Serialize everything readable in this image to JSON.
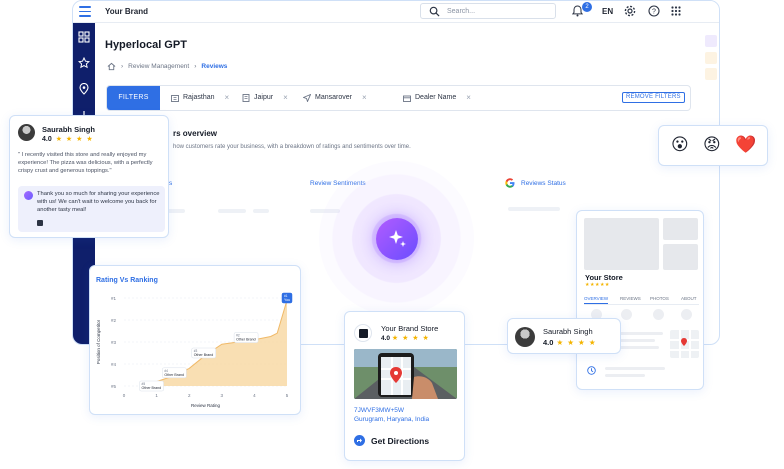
{
  "header": {
    "brand": "Your Brand",
    "search_placeholder": "Search...",
    "notification_count": "2",
    "language": "EN"
  },
  "page": {
    "title": "Hyperlocal GPT",
    "breadcrumb": [
      "Review Management",
      "Reviews"
    ]
  },
  "filters": {
    "button_label": "FILTERS",
    "chips": [
      "Rajasthan",
      "Jaipur",
      "Mansarover",
      "Dealer Name"
    ],
    "remove_label": "REMOVE FILTERS"
  },
  "overview": {
    "title_fragment": "rs overview",
    "subtitle_fragment": "how customers rate your business, with a breakdown of ratings and sentiments over time.",
    "left_section_fragment": "s",
    "sentiments_label": "Review Sentiments",
    "status_label": "Reviews Status"
  },
  "review_card": {
    "name": "Saurabh Singh",
    "rating": "4.0",
    "stars": "★ ★ ★ ★",
    "quote": "\" I recently visited this store and really enjoyed my experience! The pizza was delicious, with a perfectly crispy crust and generous toppings.\"",
    "reply": "Thank you so much for sharing your experience with us! We can't wait to welcome you back for another tasty meal!"
  },
  "emojis": [
    "😮",
    "😡",
    "❤️"
  ],
  "chart_data": {
    "type": "area",
    "title": "Rating Vs Ranking",
    "xlabel": "Review Rating",
    "ylabel": "Position of Competitor",
    "x_ticks": [
      "0",
      "1",
      "2",
      "3",
      "4",
      "5"
    ],
    "y_ticks": [
      "#1",
      "#2",
      "#3",
      "#4",
      "#5"
    ],
    "x": [
      1,
      1.5,
      2,
      2.5,
      3,
      3.5,
      4,
      4.5,
      4.7,
      5
    ],
    "y": [
      4.8,
      4.55,
      4.2,
      3.6,
      3.1,
      3.0,
      2.9,
      2.75,
      2.6,
      1.1
    ],
    "annotations": [
      {
        "id": "#5",
        "label": "Other Brand",
        "x": 0.6,
        "y": 5
      },
      {
        "id": "#4",
        "label": "Other Brand",
        "x": 1.3,
        "y": 4.4
      },
      {
        "id": "#3",
        "label": "Other Brand",
        "x": 2.2,
        "y": 3.5
      },
      {
        "id": "#2",
        "label": "Other Brand",
        "x": 3.5,
        "y": 2.8
      },
      {
        "id": "#1",
        "label": "You",
        "x": 5,
        "y": 1
      }
    ]
  },
  "store_card": {
    "name": "Your Brand Store",
    "rating": "4.0",
    "stars": "★ ★ ★ ★",
    "address_code": "7JWVF3MW+5W",
    "address_city": "Gurugram, Haryana, India",
    "directions_label": "Get Directions"
  },
  "profile_card": {
    "name": "Your Store",
    "stars": "★★★★★",
    "tabs": [
      "OVERVIEW",
      "REVIEWS",
      "PHOTOS",
      "ABOUT"
    ]
  },
  "reviewer_card": {
    "name": "Saurabh Singh",
    "rating": "4.0",
    "stars": "★ ★ ★ ★"
  },
  "colors": {
    "accent": "#2f6fe4",
    "nav": "#0f1f6b",
    "chart_fill": "#f8d9a6",
    "star": "#f4b400"
  }
}
